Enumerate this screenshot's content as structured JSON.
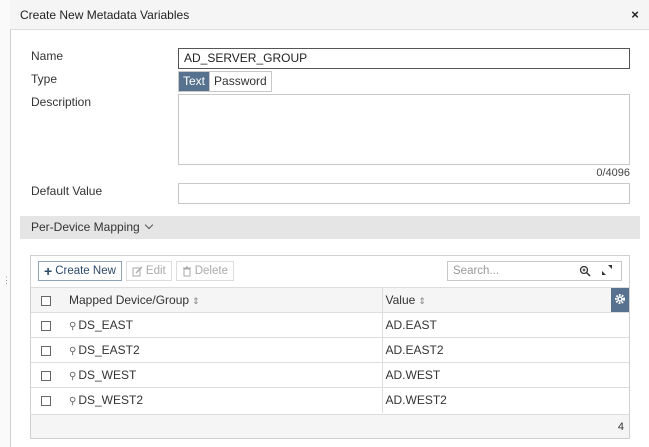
{
  "dialog": {
    "title": "Create New Metadata Variables",
    "close_glyph": "×"
  },
  "form": {
    "name_label": "Name",
    "name_value": "AD_SERVER_GROUP",
    "type_label": "Type",
    "type_options": [
      "Text",
      "Password"
    ],
    "type_selected": "Text",
    "description_label": "Description",
    "description_value": "",
    "description_count": "0/4096",
    "default_label": "Default Value",
    "default_value": ""
  },
  "mapping": {
    "section_label": "Per-Device Mapping",
    "toolbar": {
      "create_label": "Create New",
      "edit_label": "Edit",
      "delete_label": "Delete",
      "search_placeholder": "Search..."
    },
    "columns": [
      "Mapped Device/Group",
      "Value"
    ],
    "rows": [
      {
        "device": "DS_EAST",
        "value": "AD.EAST"
      },
      {
        "device": "DS_EAST2",
        "value": "AD.EAST2"
      },
      {
        "device": "DS_WEST",
        "value": "AD.WEST"
      },
      {
        "device": "DS_WEST2",
        "value": "AD.WEST2"
      }
    ],
    "total": "4"
  },
  "icons": {
    "close": "close-icon",
    "create": "plus-icon",
    "edit": "edit-icon",
    "delete": "trash-icon",
    "search": "search-icon",
    "expand": "expand-icon",
    "settings": "gear-icon",
    "device_group": "device-group-icon",
    "sort": "sort-icon"
  },
  "colors": {
    "accent": "#56728f",
    "section_bg": "#e5e5e5"
  }
}
